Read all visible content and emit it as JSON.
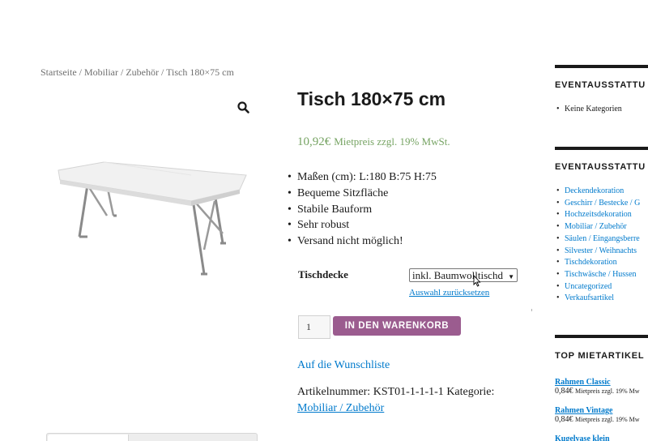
{
  "breadcrumb": {
    "items": [
      "Startseite",
      "Mobiliar",
      "Zubehör",
      "Tisch 180×75 cm"
    ],
    "separator": " / "
  },
  "product": {
    "title": "Tisch 180×75 cm",
    "price": "10,92€",
    "price_suffix": "Mietpreis zzgl. 19% MwSt.",
    "features": [
      "Maßen (cm): L:180 B:75 H:75",
      "Bequeme Sitzfläche",
      "Stabile Bauform",
      "Sehr robust",
      "Versand nicht möglich!"
    ],
    "image_icon": "folding-table-image"
  },
  "variation": {
    "label": "Tischdecke",
    "selected": "inkl. Baumwolltischd",
    "reset_label": "Auswahl zurücksetzen"
  },
  "cart": {
    "quantity": "1",
    "button_label": "IN DEN WARENKORB"
  },
  "wishlist_label": "Auf die Wunschliste",
  "meta": {
    "sku_label": "Artikelnummer:",
    "sku": "KST01-1-1-1-1",
    "category_label": "Kategorie:",
    "category": "Mobiliar / Zubehör"
  },
  "sidebar": {
    "widget1": {
      "title": "EVENTAUSSTATTU",
      "items": [
        "Keine Kategorien"
      ]
    },
    "widget2": {
      "title": "EVENTAUSSTATTU",
      "items": [
        "Deckendekoration",
        "Geschirr / Bestecke / G",
        "Hochzeitsdekoration",
        "Mobiliar / Zubehör",
        "Säulen / Eingangsberre",
        "Silvester / Weihnachts",
        "Tischdekoration",
        "Tischwäsche / Hussen",
        "Uncategorized",
        "Verkaufsartikel"
      ]
    },
    "widget3": {
      "title": "TOP MIETARTIKEL",
      "items": [
        {
          "name": "Rahmen Classic",
          "price": "0,84€",
          "suffix": "Mietpreis zzgl. 19% Mw"
        },
        {
          "name": "Rahmen Vintage",
          "price": "0,84€",
          "suffix": "Mietpreis zzgl. 19% Mw"
        },
        {
          "name": "Kugelvase klein",
          "price": "",
          "suffix": ""
        }
      ]
    }
  },
  "colors": {
    "price_green": "#77a464",
    "button_purple": "#9b5c8f",
    "link_blue": "#007acc"
  },
  "icons": {
    "zoom": "magnifier-icon",
    "select_arrow": "triangle-down-icon"
  }
}
